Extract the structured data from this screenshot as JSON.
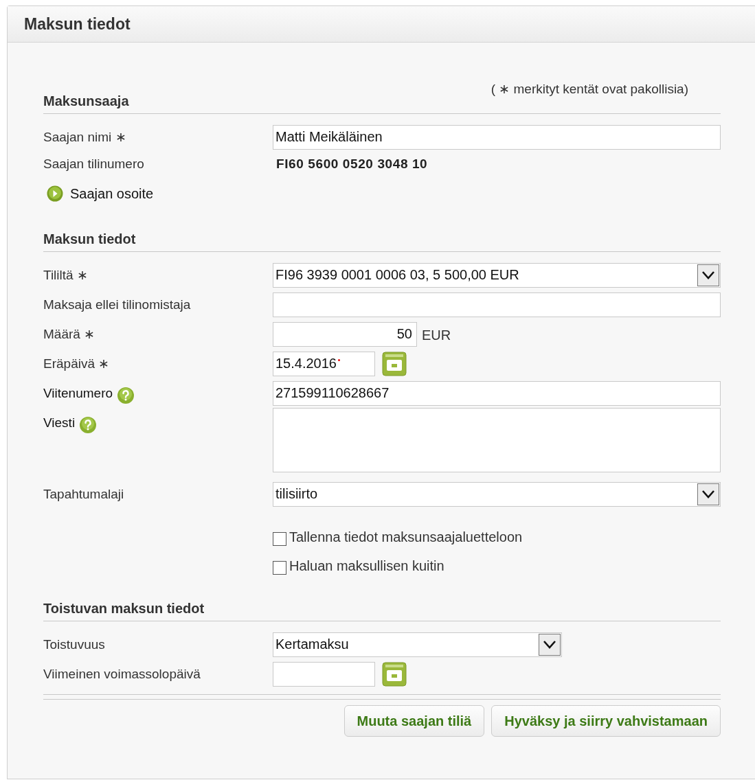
{
  "panel_title": "Maksun tiedot",
  "required_note": "( ∗ merkityt kentät ovat pakollisia)",
  "sections": [
    {
      "title": "Maksunsaaja",
      "rows": [
        {
          "kind": "input",
          "label": "Saajan nimi ∗",
          "value": "Matti Meikäläinen"
        },
        {
          "kind": "static",
          "label": "Saajan tilinumero",
          "value": "FI60 5600 0520 3048 10"
        },
        {
          "kind": "link",
          "label": "Saajan osoite"
        }
      ]
    },
    {
      "title": "Maksun tiedot",
      "rows": [
        {
          "kind": "select",
          "label": "Tililtä ∗",
          "value": "FI96 3939 0001 0006 03, 5 500,00 EUR"
        },
        {
          "kind": "input",
          "label": "Maksaja ellei tilinomistaja"
        },
        {
          "kind": "amount",
          "label": "Määrä ∗",
          "value": "50",
          "unit": "EUR"
        },
        {
          "kind": "date",
          "label": "Eräpäivä ∗",
          "value": "15.4.2016",
          "flagged": true
        },
        {
          "kind": "input",
          "label": "Viitenumero",
          "value": "271599110628667",
          "help": true
        },
        {
          "kind": "textarea",
          "label": "Viesti",
          "help": true
        },
        {
          "kind": "select",
          "label": "Tapahtumalaji",
          "value": "tilisiirto"
        },
        {
          "kind": "checkbox",
          "text": "Tallenna tiedot maksunsaajaluetteloon",
          "checked": false
        },
        {
          "kind": "checkbox",
          "text": "Haluan maksullisen kuitin",
          "checked": false
        }
      ]
    },
    {
      "title": "Toistuvan maksun tiedot",
      "rows": [
        {
          "kind": "select",
          "label": "Toistuvuus",
          "value": "Kertamaksu",
          "short": true
        },
        {
          "kind": "date",
          "label": "Viimeinen voimassolopäivä",
          "flagged": false
        }
      ]
    }
  ],
  "buttons": [
    "Muuta saajan tiliä",
    "Hyväksy ja siirry vahvistamaan"
  ]
}
